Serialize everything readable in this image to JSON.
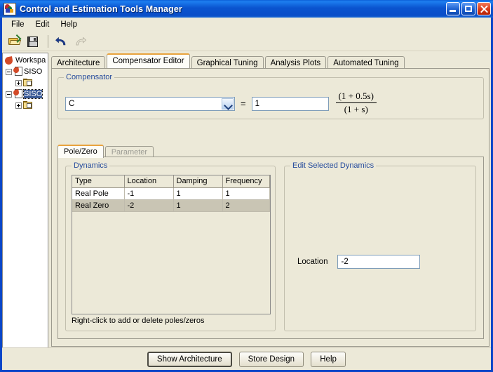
{
  "window": {
    "title": "Control and Estimation Tools Manager",
    "icon": "matlab-icon",
    "buttons": {
      "minimize": "minimize-button",
      "maximize": "maximize-button",
      "close": "close-button"
    }
  },
  "menu": {
    "items": [
      {
        "label": "File"
      },
      {
        "label": "Edit"
      },
      {
        "label": "Help"
      }
    ]
  },
  "toolbar": {
    "items": [
      {
        "name": "open-icon",
        "title": "Open"
      },
      {
        "name": "save-icon",
        "title": "Save"
      },
      {
        "name": "undo-icon",
        "title": "Undo"
      },
      {
        "name": "redo-icon",
        "title": "Redo"
      }
    ]
  },
  "tree": {
    "root": {
      "label": "Workspa",
      "icon": "matlab-icon"
    },
    "nodes": [
      {
        "label": "SISO",
        "icon": "sisotool-doc-icon",
        "selected": false,
        "child": {
          "label": "",
          "icon": "folder-icon"
        }
      },
      {
        "label": "SISO",
        "icon": "sisotool-doc-icon",
        "selected": true,
        "child": {
          "label": "",
          "icon": "folder-icon"
        }
      }
    ],
    "scrollbar": {
      "left": "scroll-left-arrow",
      "right": "scroll-right-arrow"
    }
  },
  "tabs": [
    {
      "label": "Architecture",
      "active": false
    },
    {
      "label": "Compensator Editor",
      "active": true
    },
    {
      "label": "Graphical Tuning",
      "active": false
    },
    {
      "label": "Analysis Plots",
      "active": false
    },
    {
      "label": "Automated Tuning",
      "active": false
    }
  ],
  "compensator": {
    "group_label": "Compensator",
    "selector_value": "C",
    "equals": "=",
    "gain_value": "1",
    "transfer_function": {
      "numerator": "(1 + 0.5s)",
      "denominator": "(1 + s)"
    }
  },
  "subtabs": [
    {
      "label": "Pole/Zero",
      "active": true,
      "disabled": false
    },
    {
      "label": "Parameter",
      "active": false,
      "disabled": true
    }
  ],
  "dynamics": {
    "group_label": "Dynamics",
    "columns": [
      "Type",
      "Location",
      "Damping",
      "Frequency"
    ],
    "rows": [
      {
        "cells": [
          "Real Pole",
          "-1",
          "1",
          "1"
        ],
        "selected": false
      },
      {
        "cells": [
          "Real Zero",
          "-2",
          "1",
          "2"
        ],
        "selected": true
      }
    ],
    "hint": "Right-click to add or delete poles/zeros"
  },
  "edit_selected": {
    "group_label": "Edit Selected Dynamics",
    "location_label": "Location",
    "location_value": "-2"
  },
  "footer": {
    "buttons": [
      {
        "label": "Show Architecture",
        "default": true
      },
      {
        "label": "Store Design",
        "default": false
      },
      {
        "label": "Help",
        "default": false
      }
    ]
  },
  "colors": {
    "titlebar_blue": "#0a4ec8",
    "window_face": "#ece9d8",
    "group_label_blue": "#254b9c",
    "active_tab_accent": "#e8a33d",
    "selection_blue": "#3a5a96",
    "row_selected": "#c9c5b4"
  }
}
